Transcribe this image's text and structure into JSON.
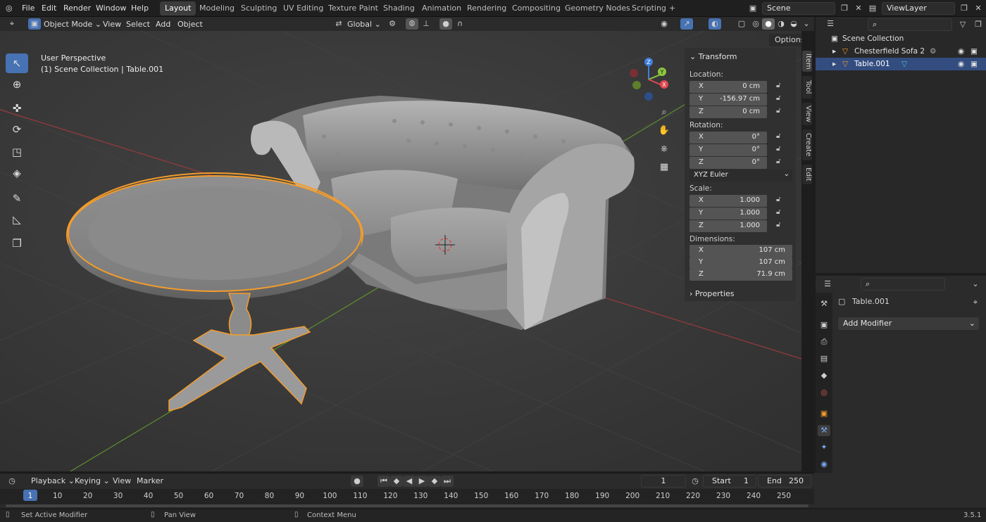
{
  "menu": [
    "File",
    "Edit",
    "Render",
    "Window",
    "Help"
  ],
  "workspaces": [
    "Layout",
    "Modeling",
    "Sculpting",
    "UV Editing",
    "Texture Paint",
    "Shading",
    "Animation",
    "Rendering",
    "Compositing",
    "Geometry Nodes",
    "Scripting"
  ],
  "scene_name": "Scene",
  "view_layer": "ViewLayer",
  "viewport_header": {
    "mode": "Object Mode",
    "menus": [
      "View",
      "Select",
      "Add",
      "Object"
    ],
    "orientation": "Global",
    "options_label": "Options"
  },
  "viewport": {
    "perspective": "User Perspective",
    "collection_line": "(1) Scene Collection | Table.001"
  },
  "gizmo_axes": {
    "x": "X",
    "y": "Y",
    "z": "Z"
  },
  "npanel": {
    "title": "Transform",
    "location_label": "Location:",
    "location": {
      "x": "0 cm",
      "y": "-156.97 cm",
      "z": "0 cm"
    },
    "rotation_label": "Rotation:",
    "rotation": {
      "x": "0°",
      "y": "0°",
      "z": "0°"
    },
    "rotation_mode": "XYZ Euler",
    "scale_label": "Scale:",
    "scale": {
      "x": "1.000",
      "y": "1.000",
      "z": "1.000"
    },
    "dimensions_label": "Dimensions:",
    "dimensions": {
      "x": "107 cm",
      "y": "107 cm",
      "z": "71.9 cm"
    },
    "properties_label": "Properties",
    "axes": {
      "x": "X",
      "y": "Y",
      "z": "Z"
    },
    "tabs": [
      "Item",
      "Tool",
      "View",
      "Create",
      "Edit"
    ]
  },
  "outliner": {
    "root": "Scene Collection",
    "items": [
      {
        "label": "Chesterfield Sofa 2",
        "selected": false
      },
      {
        "label": "Table.001",
        "selected": true
      }
    ]
  },
  "properties": {
    "object_name": "Table.001",
    "add_modifier": "Add Modifier"
  },
  "timeline": {
    "menus": [
      "Playback",
      "Keying",
      "View",
      "Marker"
    ],
    "current_frame": "1",
    "start_label": "Start",
    "start": "1",
    "end_label": "End",
    "end": "250",
    "frames": [
      "1",
      "10",
      "20",
      "30",
      "40",
      "50",
      "60",
      "70",
      "80",
      "90",
      "100",
      "110",
      "120",
      "130",
      "140",
      "150",
      "160",
      "170",
      "180",
      "190",
      "200",
      "210",
      "220",
      "230",
      "240",
      "250"
    ]
  },
  "status": {
    "left": "Set Active Modifier",
    "middle": "Pan View",
    "right": "Context Menu",
    "version": "3.5.1"
  },
  "colors": {
    "accent": "#4772b3",
    "selection_outline": "#f39c2c",
    "x_axis": "#e0484f",
    "y_axis": "#8ec63f",
    "z_axis": "#3f7fe0"
  }
}
